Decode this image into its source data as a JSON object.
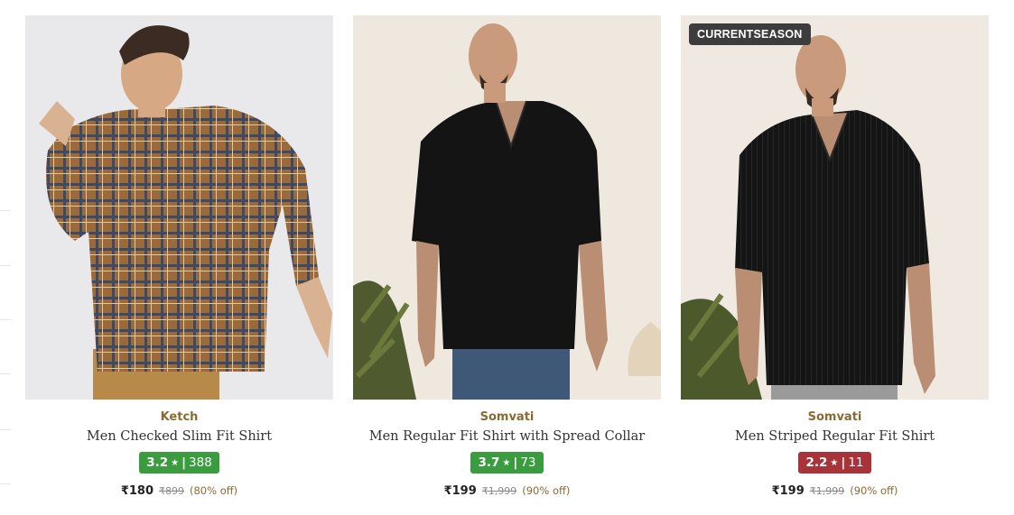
{
  "products": [
    {
      "brand": "Ketch",
      "name": "Men Checked Slim Fit Shirt",
      "rating": "3.2",
      "rating_star": "★",
      "rating_sep": "|",
      "review_count": "388",
      "rating_color": "#3a9c3f",
      "price": "₹180",
      "mrp": "₹899",
      "discount": "(80% off)",
      "badge": ""
    },
    {
      "brand": "Somvati",
      "name": "Men Regular Fit Shirt with Spread Collar",
      "rating": "3.7",
      "rating_star": "★",
      "rating_sep": "|",
      "review_count": "73",
      "rating_color": "#3a9c3f",
      "price": "₹199",
      "mrp": "₹1,999",
      "discount": "(90% off)",
      "badge": ""
    },
    {
      "brand": "Somvati",
      "name": "Men Striped Regular Fit Shirt",
      "rating": "2.2",
      "rating_star": "★",
      "rating_sep": "|",
      "review_count": "11",
      "rating_color": "#a8343a",
      "price": "₹199",
      "mrp": "₹1,999",
      "discount": "(90% off)",
      "badge": "CURRENTSEASON"
    }
  ]
}
